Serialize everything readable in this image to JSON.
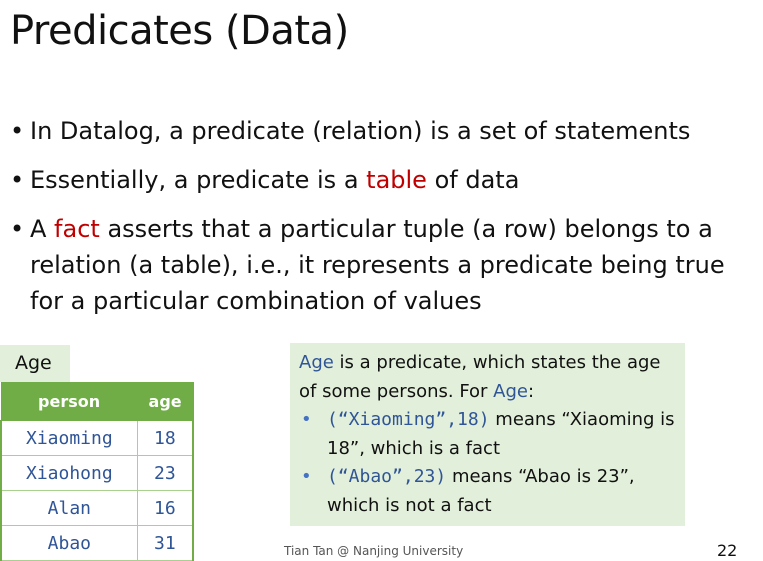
{
  "title": "Predicates (Data)",
  "bullets": {
    "b1": "In Datalog, a predicate (relation) is a set of statements",
    "b2_pre": "Essentially, a predicate is a ",
    "b2_red": "table",
    "b2_post": " of data",
    "b3_pre": "A ",
    "b3_red": "fact",
    "b3_post": " asserts that a particular tuple (a row) belongs to a relation (a table), i.e., it represents a predicate being true for a particular combination of values"
  },
  "table": {
    "name": "Age",
    "columns": [
      "person",
      "age"
    ],
    "rows": [
      [
        "Xiaoming",
        "18"
      ],
      [
        "Xiaohong",
        "23"
      ],
      [
        "Alan",
        "16"
      ],
      [
        "Abao",
        "31"
      ]
    ]
  },
  "note": {
    "intro_pred": "Age",
    "intro_rest": " is a predicate, which states the age of some persons. For ",
    "intro_pred2": "Age",
    "intro_colon": ":",
    "item1_code": "(“Xiaoming”,18)",
    "item1_text": " means “Xiaoming is 18”, which is a fact",
    "item2_code": "(“Abao”,23)",
    "item2_text": " means “Abao is 23”, which is not a fact"
  },
  "footer": "Tian Tan @ Nanjing University",
  "page_number": "22",
  "colors": {
    "accent_red": "#c00000",
    "header_green": "#70ad47",
    "light_green": "#e2efda",
    "text_blue": "#2f5597"
  }
}
